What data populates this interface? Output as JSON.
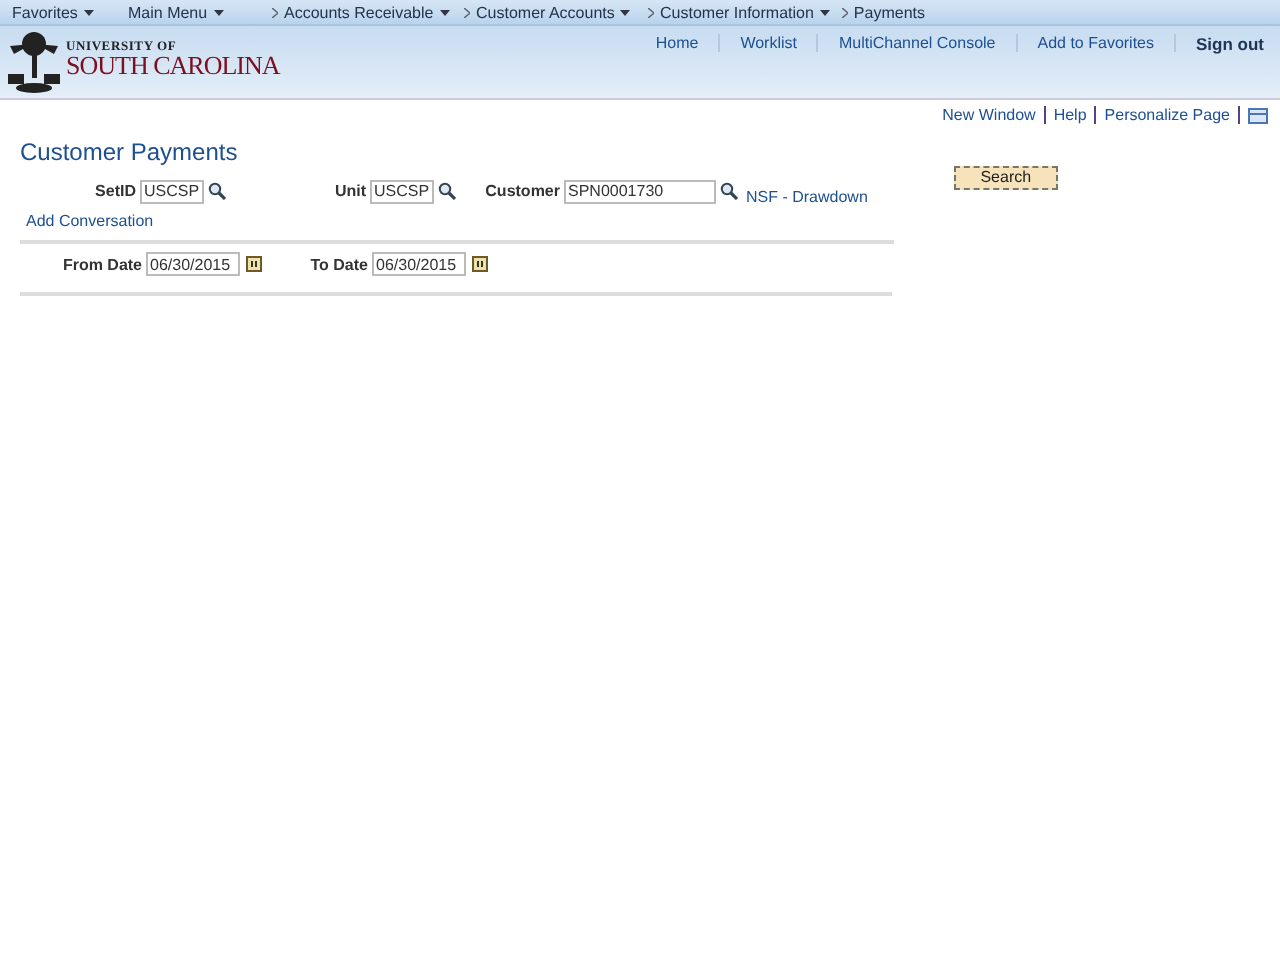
{
  "nav": {
    "items": [
      {
        "label": "Favorites",
        "dropdown": true,
        "separator": false
      },
      {
        "label": "Main Menu",
        "dropdown": true,
        "separator": false
      },
      {
        "label": "Accounts Receivable",
        "dropdown": true,
        "separator": true
      },
      {
        "label": "Customer Accounts",
        "dropdown": true,
        "separator": true
      },
      {
        "label": "Customer Information",
        "dropdown": true,
        "separator": true
      },
      {
        "label": "Payments",
        "dropdown": false,
        "separator": true
      }
    ]
  },
  "header": {
    "logo_top": "UNIVERSITY OF",
    "logo_bottom": "SOUTH CAROLINA",
    "links": [
      "Home",
      "Worklist",
      "MultiChannel Console",
      "Add to Favorites"
    ],
    "sign_out": "Sign out"
  },
  "page_links": [
    "New Window",
    "Help",
    "Personalize Page"
  ],
  "title": "Customer Payments",
  "fields": [
    {
      "label": "SetID",
      "value": "USCSP"
    },
    {
      "label": "Unit",
      "value": "USCSP"
    },
    {
      "label": "Customer",
      "value": "SPN0001730"
    }
  ],
  "customer_name": "NSF - Drawdown",
  "search_button": "Search",
  "add_conversation": "Add Conversation",
  "dates": [
    {
      "label": "From Date",
      "value": "06/30/2015"
    },
    {
      "label": "To Date",
      "value": "06/30/2015"
    }
  ]
}
